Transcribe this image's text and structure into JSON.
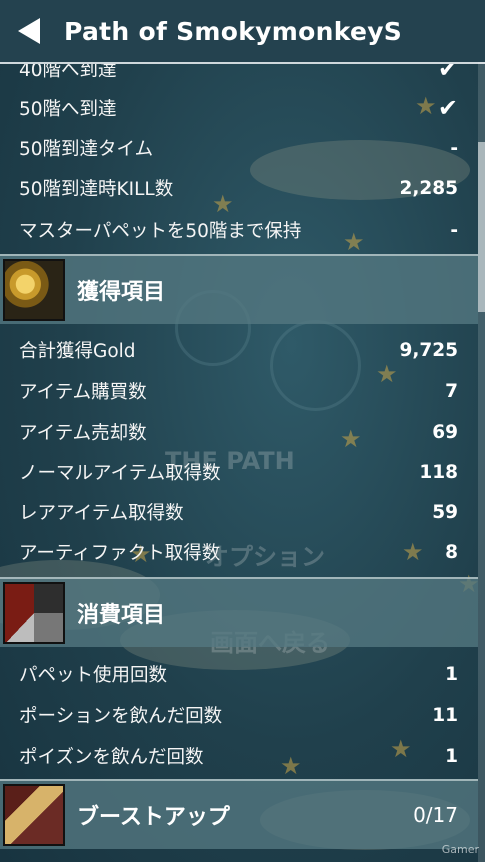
{
  "header": {
    "title": "Path of SmokymonkeyS"
  },
  "top_rows": [
    {
      "label": "40階へ到達",
      "value": "✔"
    },
    {
      "label": "50階へ到達",
      "value": "✔"
    },
    {
      "label": "50階到達タイム",
      "value": "-"
    },
    {
      "label": "50階到達時KILL数",
      "value": "2,285"
    },
    {
      "label": "マスターパペットを50階まで保持",
      "value": "-"
    }
  ],
  "sections": [
    {
      "title": "獲得項目",
      "icon": "gold-coins-icon",
      "rows": [
        {
          "label": "合計獲得Gold",
          "value": "9,725"
        },
        {
          "label": "アイテム購買数",
          "value": "7"
        },
        {
          "label": "アイテム売却数",
          "value": "69"
        },
        {
          "label": "ノーマルアイテム取得数",
          "value": "118"
        },
        {
          "label": "レアアイテム取得数",
          "value": "59"
        },
        {
          "label": "アーティファクト取得数",
          "value": "8"
        }
      ]
    },
    {
      "title": "消費項目",
      "icon": "puppet-icon",
      "rows": [
        {
          "label": "パペット使用回数",
          "value": "1"
        },
        {
          "label": "ポーションを飲んだ回数",
          "value": "11"
        },
        {
          "label": "ポイズンを飲んだ回数",
          "value": "1"
        }
      ]
    },
    {
      "title": "ブーストアップ",
      "icon": "boost-icon",
      "value": "0/17"
    }
  ],
  "background_text": {
    "path_logo": "THE PATH",
    "option": "オプション",
    "back_screen": "画面へ戻る"
  },
  "watermark": "Gamer",
  "colors": {
    "check": "#f0c020",
    "header_bg": "#24424f",
    "section_bg": "#55788a"
  }
}
